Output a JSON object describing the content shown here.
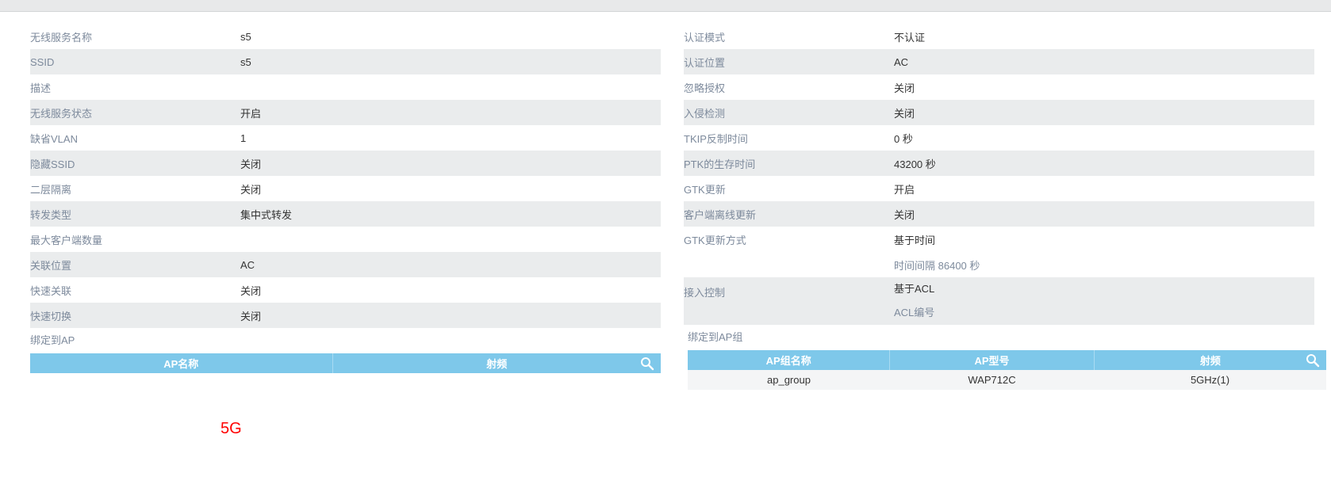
{
  "left_panel": {
    "rows": [
      {
        "label": "无线服务名称",
        "value": "s5"
      },
      {
        "label": "SSID",
        "value": "s5"
      },
      {
        "label": "描述",
        "value": ""
      },
      {
        "label": "无线服务状态",
        "value": "开启"
      },
      {
        "label": "缺省VLAN",
        "value": "1"
      },
      {
        "label": "隐藏SSID",
        "value": "关闭"
      },
      {
        "label": "二层隔离",
        "value": "关闭"
      },
      {
        "label": "转发类型",
        "value": "集中式转发"
      },
      {
        "label": "最大客户端数量",
        "value": ""
      },
      {
        "label": "关联位置",
        "value": "AC"
      },
      {
        "label": "快速关联",
        "value": "关闭"
      },
      {
        "label": "快速切换",
        "value": "关闭"
      }
    ],
    "bind_section": "绑定到AP",
    "grid": {
      "columns": [
        "AP名称",
        "射频"
      ]
    }
  },
  "right_panel": {
    "rows": [
      {
        "label": "认证模式",
        "value": "不认证"
      },
      {
        "label": "认证位置",
        "value": "AC"
      },
      {
        "label": "忽略授权",
        "value": "关闭"
      },
      {
        "label": "入侵检测",
        "value": "关闭"
      },
      {
        "label": "TKIP反制时间",
        "value": "0 秒"
      },
      {
        "label": "PTK的生存时间",
        "value": "43200 秒"
      },
      {
        "label": "GTK更新",
        "value": "开启"
      },
      {
        "label": "客户端离线更新",
        "value": "关闭"
      },
      {
        "label": "GTK更新方式",
        "value": "基于时间"
      }
    ],
    "gtk_interval_label": "时间间隔",
    "gtk_interval_value": "86400 秒",
    "access_control": {
      "label": "接入控制",
      "value": "基于ACL",
      "sub_label": "ACL编号"
    },
    "bind_section": "绑定到AP组",
    "grid": {
      "columns": [
        "AP组名称",
        "AP型号",
        "射频"
      ],
      "rows": [
        [
          "ap_group",
          "WAP712C",
          "5GHz(1)"
        ]
      ]
    }
  },
  "annotation": "5G"
}
